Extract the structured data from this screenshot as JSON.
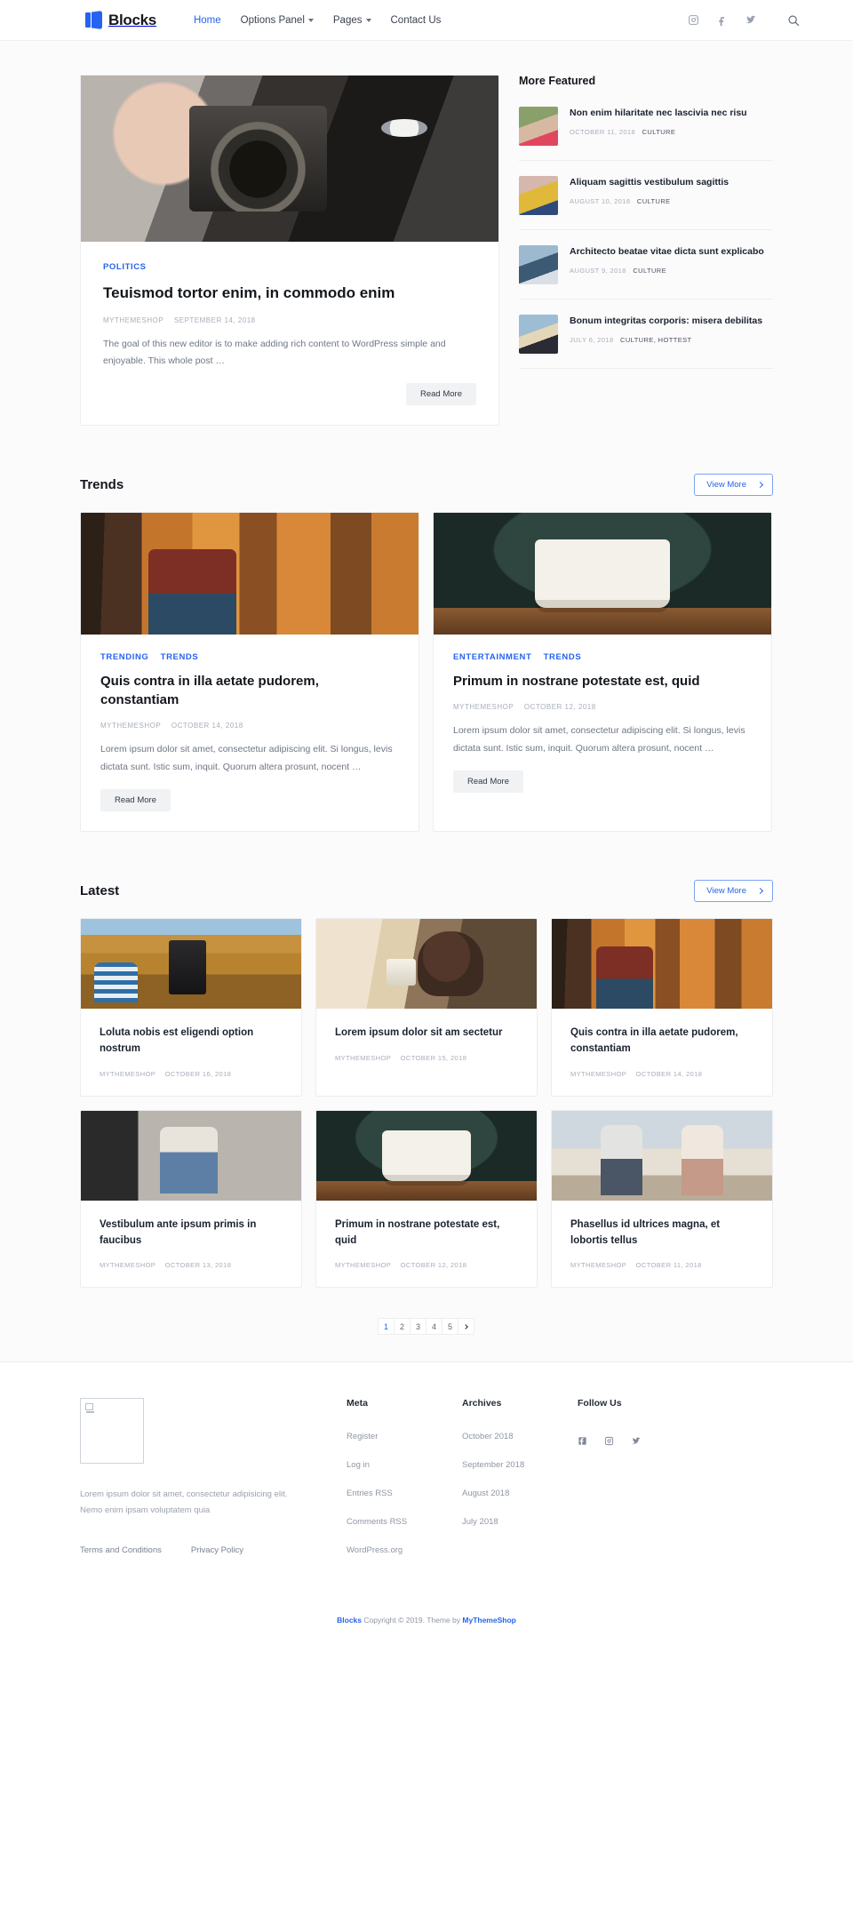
{
  "header": {
    "brand": "Blocks",
    "nav": [
      {
        "label": "Home",
        "active": true,
        "caret": false
      },
      {
        "label": "Options Panel",
        "active": false,
        "caret": true
      },
      {
        "label": "Pages",
        "active": false,
        "caret": true
      },
      {
        "label": "Contact Us",
        "active": false,
        "caret": false
      }
    ],
    "social": [
      "instagram-icon",
      "facebook-icon",
      "twitter-icon"
    ],
    "search": "search-icon"
  },
  "hero": {
    "category": "POLITICS",
    "title": "Teuismod tortor enim, in commodo enim",
    "author": "MYTHEMESHOP",
    "date": "SEPTEMBER 14, 2018",
    "excerpt": "The goal of this new editor is to make adding rich content to WordPress simple and enjoyable. This whole post …",
    "read_more": "Read More"
  },
  "sidebar": {
    "title": "More Featured",
    "items": [
      {
        "title": "Non enim hilaritate nec lascivia nec risu",
        "date": "OCTOBER 11, 2018",
        "cat": "CULTURE"
      },
      {
        "title": "Aliquam sagittis vestibulum sagittis",
        "date": "AUGUST 10, 2018",
        "cat": "CULTURE"
      },
      {
        "title": "Architecto beatae vitae dicta sunt explicabo",
        "date": "AUGUST 9, 2018",
        "cat": "CULTURE"
      },
      {
        "title": "Bonum integritas corporis: misera debilitas",
        "date": "JULY 6, 2018",
        "cat": "CULTURE, HOTTEST"
      }
    ]
  },
  "trends": {
    "heading": "Trends",
    "view_more": "View More",
    "cards": [
      {
        "cats": [
          "TRENDING",
          "TRENDS"
        ],
        "title": "Quis contra in illa aetate pudorem, constantiam",
        "author": "MYTHEMESHOP",
        "date": "OCTOBER 14, 2018",
        "excerpt": "Lorem ipsum dolor sit amet, consectetur adipiscing elit. Si longus, levis dictata sunt. Istic sum, inquit. Quorum altera prosunt, nocent …",
        "read_more": "Read More"
      },
      {
        "cats": [
          "ENTERTAINMENT",
          "TRENDS"
        ],
        "title": "Primum in nostrane potestate est, quid",
        "author": "MYTHEMESHOP",
        "date": "OCTOBER 12, 2018",
        "excerpt": "Lorem ipsum dolor sit amet, consectetur adipiscing elit. Si longus, levis dictata sunt. Istic sum, inquit. Quorum altera prosunt, nocent …",
        "read_more": "Read More"
      }
    ]
  },
  "latest": {
    "heading": "Latest",
    "view_more": "View More",
    "cards": [
      {
        "title": "Loluta nobis est eligendi option nostrum",
        "author": "MYTHEMESHOP",
        "date": "OCTOBER 16, 2018"
      },
      {
        "title": "Lorem ipsum dolor sit am sectetur",
        "author": "MYTHEMESHOP",
        "date": "OCTOBER 15, 2018"
      },
      {
        "title": "Quis contra in illa aetate pudorem, constantiam",
        "author": "MYTHEMESHOP",
        "date": "OCTOBER 14, 2018"
      },
      {
        "title": "Vestibulum ante ipsum primis in faucibus",
        "author": "MYTHEMESHOP",
        "date": "OCTOBER 13, 2018"
      },
      {
        "title": "Primum in nostrane potestate est, quid",
        "author": "MYTHEMESHOP",
        "date": "OCTOBER 12, 2018"
      },
      {
        "title": "Phasellus id ultrices magna, et lobortis tellus",
        "author": "MYTHEMESHOP",
        "date": "OCTOBER 11, 2018"
      }
    ]
  },
  "pagination": {
    "pages": [
      "1",
      "2",
      "3",
      "4",
      "5"
    ],
    "current": "1",
    "next_icon": "chevron-right-icon"
  },
  "footer": {
    "about": "Lorem ipsum dolor sit amet, consectetur adipisicing elit. Nemo enim ipsam voluptatem quia",
    "legal": [
      {
        "label": "Terms and Conditions"
      },
      {
        "label": "Privacy Policy"
      }
    ],
    "meta": {
      "heading": "Meta",
      "items": [
        "Register",
        "Log in",
        "Entries RSS",
        "Comments RSS",
        "WordPress.org"
      ]
    },
    "archives": {
      "heading": "Archives",
      "items": [
        "October 2018",
        "September 2018",
        "August 2018",
        "July 2018"
      ]
    },
    "follow": {
      "heading": "Follow Us",
      "icons": [
        "facebook-icon",
        "instagram-icon",
        "twitter-icon"
      ]
    },
    "copyright": {
      "brand": "Blocks",
      "text": " Copyright © 2019. Theme by ",
      "author": "MyThemeShop"
    }
  },
  "colors": {
    "accent": "#2563f0",
    "text_dark": "#13161c",
    "text_muted": "#a8aebb",
    "page_bg": "#fbfbfc"
  }
}
